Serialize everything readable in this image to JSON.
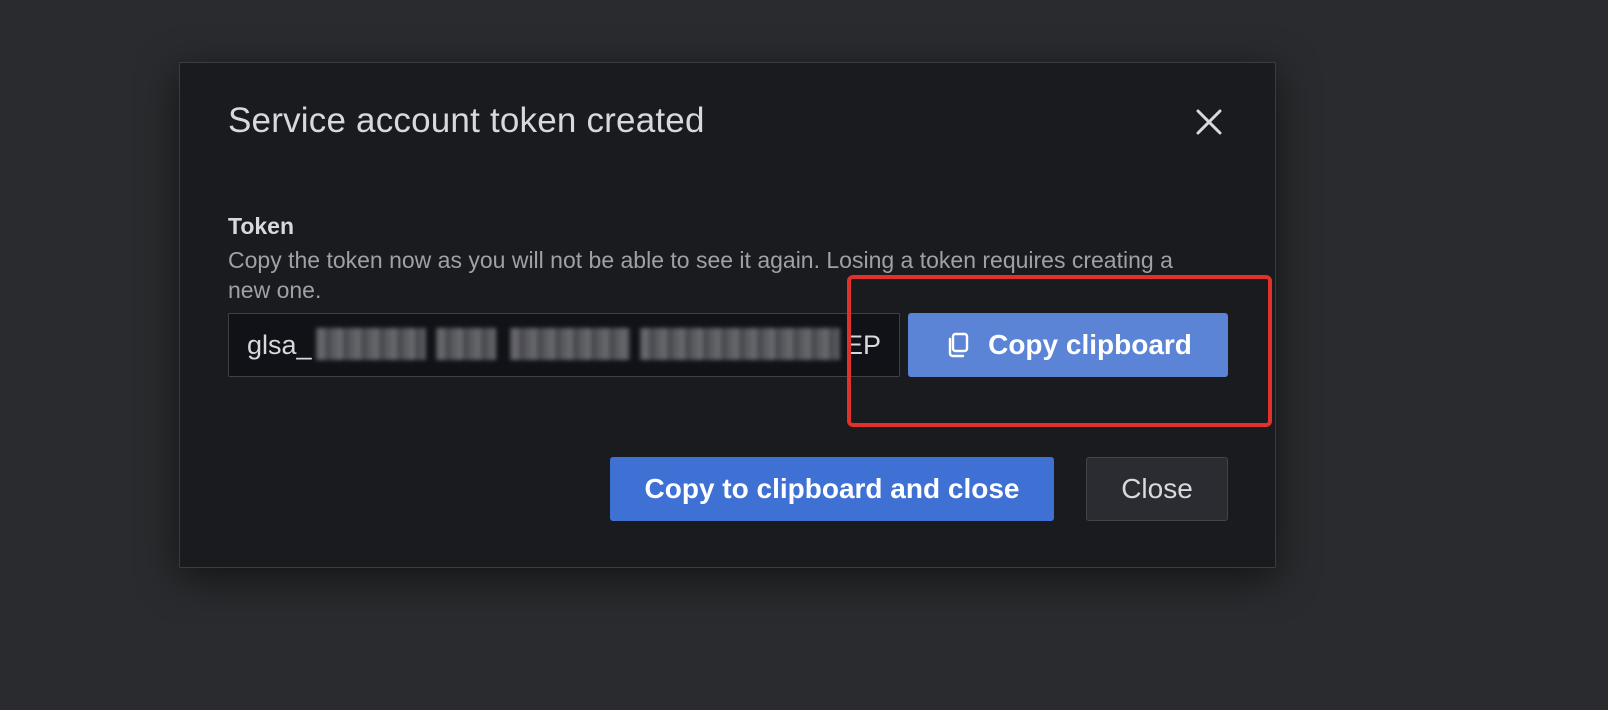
{
  "modal": {
    "title": "Service account token created",
    "close_icon": "close-icon"
  },
  "token": {
    "label": "Token",
    "description": "Copy the token now as you will not be able to see it again. Losing a token requires creating a new one.",
    "value": "glsa_",
    "value_end": "EP"
  },
  "buttons": {
    "copy_clipboard": "Copy clipboard",
    "copy_icon": "copy-icon",
    "copy_and_close": "Copy to clipboard and close",
    "close": "Close"
  },
  "colors": {
    "backdrop": "#2a2b2e",
    "modal_bg": "#191b1f",
    "primary": "#3f71d4",
    "copy_button": "#5b84d6",
    "highlight": "#e0322b"
  }
}
